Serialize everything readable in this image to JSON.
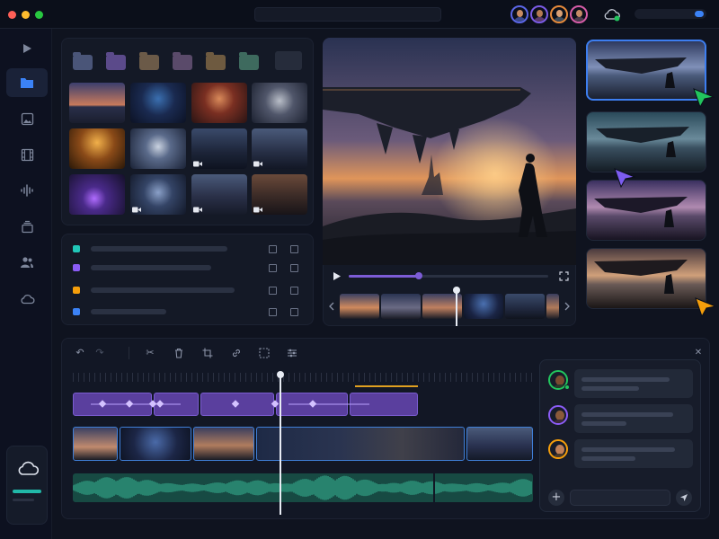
{
  "colors": {
    "accent_blue": "#3b82f6",
    "accent_purple": "#7c5cd6",
    "accent_teal": "#21b8a8",
    "accent_orange": "#f59e0b",
    "window_bg": "#0f131f",
    "window_controls": [
      "#ff5f57",
      "#febc2e",
      "#28c840"
    ]
  },
  "titlebar": {
    "collaborators": [
      {
        "name": "collaborator-1",
        "ring": "#5b66e6",
        "shirt": "#3b4a8c"
      },
      {
        "name": "collaborator-2",
        "ring": "#7b5ce6",
        "shirt": "#5b3a6c"
      },
      {
        "name": "collaborator-3",
        "ring": "#e68a3b",
        "shirt": "#3a4a5c"
      },
      {
        "name": "collaborator-4",
        "ring": "#d65ca8",
        "shirt": "#4a3a4c"
      }
    ],
    "sync_icon": "cloud-check-icon",
    "toggle_on": true
  },
  "sidebar": {
    "items": [
      {
        "icon": "play-icon",
        "active": false
      },
      {
        "icon": "folder-icon",
        "active": true
      },
      {
        "icon": "image-icon",
        "active": false
      },
      {
        "icon": "film-icon",
        "active": false
      },
      {
        "icon": "audio-wave-icon",
        "active": false
      },
      {
        "icon": "layers-icon",
        "active": false
      },
      {
        "icon": "users-icon",
        "active": false
      },
      {
        "icon": "cloud-icon",
        "active": false
      }
    ],
    "storage_icon": "cloud-icon"
  },
  "media_library": {
    "folders": [
      "#4a5578",
      "#5b4a8a",
      "#6b5a48",
      "#5a4a6a",
      "#6e5a40",
      "#3e6a5e",
      "#2a3040"
    ],
    "thumbnails": [
      {
        "type": "image",
        "scene": "sunset-coast"
      },
      {
        "type": "image",
        "scene": "night-city"
      },
      {
        "type": "image",
        "scene": "portrait-woman"
      },
      {
        "type": "image",
        "scene": "portrait-android"
      },
      {
        "type": "image",
        "scene": "golden-figure"
      },
      {
        "type": "image",
        "scene": "armored-soldier"
      },
      {
        "type": "video",
        "scene": "ship-over-city"
      },
      {
        "type": "video",
        "scene": "soldiers-night"
      },
      {
        "type": "image",
        "scene": "purple-beam"
      },
      {
        "type": "video",
        "scene": "mech-city"
      },
      {
        "type": "video",
        "scene": "vehicle-dusk"
      },
      {
        "type": "video",
        "scene": "desert-craft"
      }
    ]
  },
  "tracks_list": [
    {
      "color": "#21c7b8"
    },
    {
      "color": "#8b5cf6"
    },
    {
      "color": "#f59e0b"
    },
    {
      "color": "#3b82f6"
    }
  ],
  "player": {
    "progress": 0.35,
    "filmstrip_position": 0.52
  },
  "variations": {
    "cards": 4,
    "selected_index": 0,
    "cursors": [
      {
        "color": "#22c55e"
      },
      {
        "color": "#7c5cf0"
      },
      {
        "color": "#f59e0b"
      }
    ]
  },
  "timeline": {
    "toolbar_icons": [
      "undo-icon",
      "redo-icon",
      "scissors-icon",
      "trash-icon",
      "crop-icon",
      "link-icon",
      "frame-icon",
      "sliders-icon"
    ],
    "close_icon": "close-icon",
    "playhead_position": 0.45
  },
  "chat": {
    "messages": [
      {
        "avatar_ring": "#22c55e",
        "status": "online"
      },
      {
        "avatar_ring": "#8b5cf6",
        "status": "none"
      },
      {
        "avatar_ring": "#f59e0b",
        "status": "none"
      }
    ],
    "input_placeholder": "",
    "add_icon": "plus-icon",
    "send_icon": "send-icon"
  }
}
